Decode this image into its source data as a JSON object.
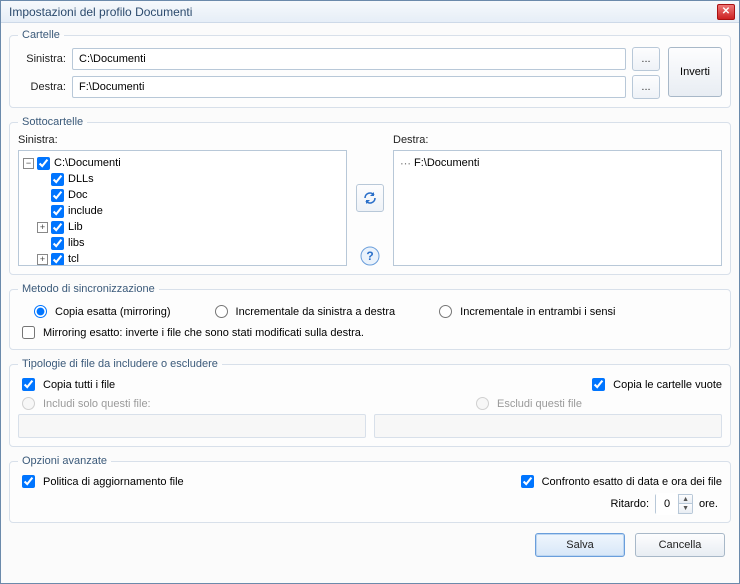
{
  "window": {
    "title": "Impostazioni del profilo Documenti"
  },
  "folders": {
    "legend": "Cartelle",
    "left_label": "Sinistra:",
    "right_label": "Destra:",
    "left_path": "C:\\Documenti",
    "right_path": "F:\\Documenti",
    "browse": "...",
    "invert": "Inverti"
  },
  "subfolders": {
    "legend": "Sottocartelle",
    "left_label": "Sinistra:",
    "right_label": "Destra:",
    "left_tree": {
      "root": "C:\\Documenti",
      "children": [
        "DLLs",
        "Doc",
        "include",
        "Lib",
        "libs",
        "tcl"
      ]
    },
    "right_tree": {
      "root": "F:\\Documenti"
    }
  },
  "sync": {
    "legend": "Metodo di sincronizzazione",
    "opt_exact": "Copia esatta (mirroring)",
    "opt_inc_lr": "Incrementale da sinistra a destra",
    "opt_inc_both": "Incrementale in entrambi i sensi",
    "mirror_exact": "Mirroring esatto: inverte i file che sono stati modificati sulla destra."
  },
  "filetypes": {
    "legend": "Tipologie di file da includere o escludere",
    "copy_all": "Copia tutti i file",
    "copy_empty": "Copia le cartelle vuote",
    "include_only": "Includi solo questi file:",
    "exclude": "Escludi questi file"
  },
  "advanced": {
    "legend": "Opzioni avanzate",
    "update_policy": "Politica di aggiornamento file",
    "exact_compare": "Confronto esatto di data e ora dei file",
    "delay_label": "Ritardo:",
    "delay_value": "0",
    "delay_unit": "ore."
  },
  "footer": {
    "save": "Salva",
    "cancel": "Cancella"
  }
}
